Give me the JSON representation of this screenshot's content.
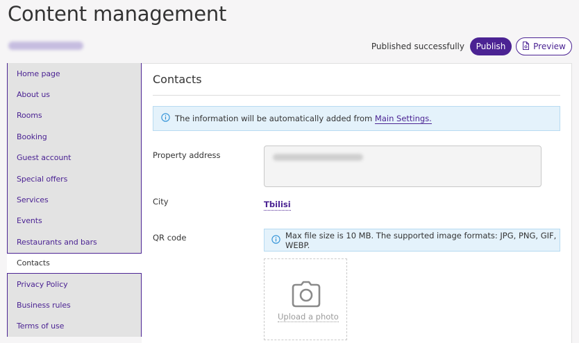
{
  "header": {
    "title": "Content management",
    "site_link": "",
    "status": "Published successfully",
    "publish_label": "Publish",
    "preview_label": "Preview"
  },
  "sidebar": {
    "items": [
      {
        "label": "Home page"
      },
      {
        "label": "About us"
      },
      {
        "label": "Rooms"
      },
      {
        "label": "Booking"
      },
      {
        "label": "Guest account"
      },
      {
        "label": "Special offers"
      },
      {
        "label": "Services"
      },
      {
        "label": "Events"
      },
      {
        "label": "Restaurants and bars"
      },
      {
        "label": "Contacts"
      },
      {
        "label": "Privacy Policy"
      },
      {
        "label": "Business rules"
      },
      {
        "label": "Terms of use"
      }
    ],
    "active": "Contacts"
  },
  "main": {
    "section_title": "Contacts",
    "info_text": "The information will be automatically added from ",
    "info_link": "Main Settings.",
    "fields": {
      "address_label": "Property address",
      "address_value": "",
      "city_label": "City",
      "city_value": "Tbilisi",
      "qr_label": "QR code",
      "qr_info": "Max file size is 10 MB. The supported image formats: JPG, PNG, GIF, WEBP.",
      "upload_label": "Upload a photo"
    }
  },
  "colors": {
    "accent": "#4b2393",
    "info_bg": "#e4f2fb",
    "sidebar_bg": "#e3e3e3"
  },
  "icons": [
    "info-icon",
    "preview-page-icon",
    "camera-icon"
  ]
}
